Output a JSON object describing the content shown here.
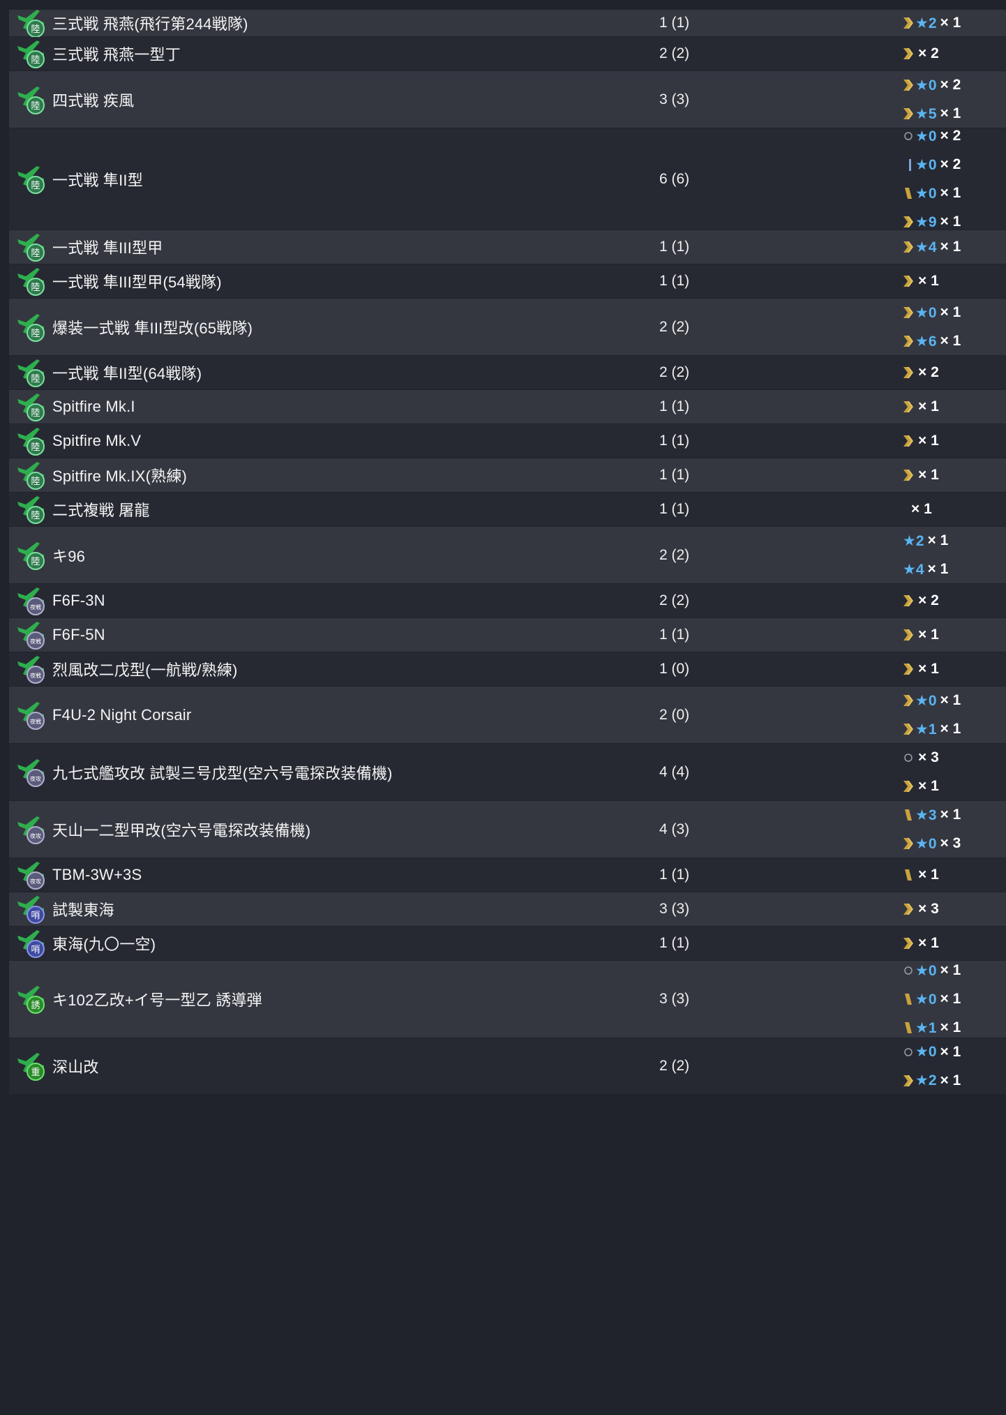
{
  "colors": {
    "background": "#20232b",
    "row_light": "#343740",
    "row_dark": "#262932",
    "star_blue": "#5ab4f2",
    "proficiency_gold": "#c9a23e",
    "proficiency_blue": "#7fa6d8",
    "proficiency_circle": "#9aa0a8"
  },
  "rows": [
    {
      "icon": "army-fighter-icon",
      "name": "三式戦 飛燕(飛行第244戦隊)",
      "count": "1 (1)",
      "levels": [
        {
          "badge": "chevron-double-gold-icon",
          "star": "★2",
          "mult": "× 1"
        }
      ]
    },
    {
      "icon": "army-fighter-icon",
      "name": "三式戦 飛燕一型丁",
      "count": "2 (2)",
      "levels": [
        {
          "badge": "chevron-double-gold-icon",
          "star": "",
          "mult": "× 2"
        }
      ]
    },
    {
      "icon": "army-fighter-icon",
      "name": "四式戦 疾風",
      "count": "3 (3)",
      "levels": [
        {
          "badge": "chevron-double-gold-icon",
          "star": "★0",
          "mult": "× 2"
        },
        {
          "badge": "chevron-double-gold-icon",
          "star": "★5",
          "mult": "× 1"
        }
      ]
    },
    {
      "icon": "army-fighter-icon",
      "name": "一式戦 隼II型",
      "count": "6 (6)",
      "levels": [
        {
          "badge": "circle-icon",
          "star": "★0",
          "mult": "× 2"
        },
        {
          "badge": "bar-blue-icon",
          "star": "★0",
          "mult": "× 2"
        },
        {
          "badge": "bars-gold-icon",
          "star": "★0",
          "mult": "× 1"
        },
        {
          "badge": "chevron-double-gold-icon",
          "star": "★9",
          "mult": "× 1"
        }
      ]
    },
    {
      "icon": "army-fighter-icon",
      "name": "一式戦 隼III型甲",
      "count": "1 (1)",
      "levels": [
        {
          "badge": "chevron-double-gold-icon",
          "star": "★4",
          "mult": "× 1"
        }
      ]
    },
    {
      "icon": "army-fighter-icon",
      "name": "一式戦 隼III型甲(54戦隊)",
      "count": "1 (1)",
      "levels": [
        {
          "badge": "chevron-double-gold-icon",
          "star": "",
          "mult": "× 1"
        }
      ]
    },
    {
      "icon": "army-fighter-icon",
      "name": "爆装一式戦 隼III型改(65戦隊)",
      "count": "2 (2)",
      "levels": [
        {
          "badge": "chevron-double-gold-icon",
          "star": "★0",
          "mult": "× 1"
        },
        {
          "badge": "chevron-double-gold-icon",
          "star": "★6",
          "mult": "× 1"
        }
      ]
    },
    {
      "icon": "army-fighter-icon",
      "name": "一式戦 隼II型(64戦隊)",
      "count": "2 (2)",
      "levels": [
        {
          "badge": "chevron-double-gold-icon",
          "star": "",
          "mult": "× 2"
        }
      ]
    },
    {
      "icon": "army-fighter-icon",
      "name": "Spitfire Mk.I",
      "count": "1 (1)",
      "levels": [
        {
          "badge": "chevron-double-gold-icon",
          "star": "",
          "mult": "× 1"
        }
      ]
    },
    {
      "icon": "army-fighter-icon",
      "name": "Spitfire Mk.V",
      "count": "1 (1)",
      "levels": [
        {
          "badge": "chevron-double-gold-icon",
          "star": "",
          "mult": "× 1"
        }
      ]
    },
    {
      "icon": "army-fighter-icon",
      "name": "Spitfire Mk.IX(熟練)",
      "count": "1 (1)",
      "levels": [
        {
          "badge": "chevron-double-gold-icon",
          "star": "",
          "mult": "× 1"
        }
      ]
    },
    {
      "icon": "army-fighter-icon",
      "name": "二式複戦 屠龍",
      "count": "1 (1)",
      "levels": [
        {
          "badge": "",
          "star": "",
          "mult": "× 1"
        }
      ]
    },
    {
      "icon": "army-fighter-icon",
      "name": "キ96",
      "count": "2 (2)",
      "levels": [
        {
          "badge": "",
          "star": "★2",
          "mult": "× 1"
        },
        {
          "badge": "",
          "star": "★4",
          "mult": "× 1"
        }
      ]
    },
    {
      "icon": "night-fighter-icon",
      "name": "F6F-3N",
      "count": "2 (2)",
      "levels": [
        {
          "badge": "chevron-double-gold-icon",
          "star": "",
          "mult": "× 2"
        }
      ]
    },
    {
      "icon": "night-fighter-icon",
      "name": "F6F-5N",
      "count": "1 (1)",
      "levels": [
        {
          "badge": "chevron-double-gold-icon",
          "star": "",
          "mult": "× 1"
        }
      ]
    },
    {
      "icon": "night-fighter-icon",
      "name": "烈風改二戊型(一航戦/熟練)",
      "count": "1 (0)",
      "levels": [
        {
          "badge": "chevron-double-gold-icon",
          "star": "",
          "mult": "× 1"
        }
      ]
    },
    {
      "icon": "night-fighter-icon",
      "name": "F4U-2 Night Corsair",
      "count": "2 (0)",
      "levels": [
        {
          "badge": "chevron-double-gold-icon",
          "star": "★0",
          "mult": "× 1"
        },
        {
          "badge": "chevron-double-gold-icon",
          "star": "★1",
          "mult": "× 1"
        }
      ]
    },
    {
      "icon": "night-attacker-icon",
      "name": "九七式艦攻改 試製三号戊型(空六号電探改装備機)",
      "count": "4 (4)",
      "levels": [
        {
          "badge": "circle-icon",
          "star": "",
          "mult": "× 3"
        },
        {
          "badge": "chevron-double-gold-icon",
          "star": "",
          "mult": "× 1"
        }
      ]
    },
    {
      "icon": "night-attacker-icon",
      "name": "天山一二型甲改(空六号電探改装備機)",
      "count": "4 (3)",
      "levels": [
        {
          "badge": "bars-gold-icon",
          "star": "★3",
          "mult": "× 1"
        },
        {
          "badge": "chevron-double-gold-icon",
          "star": "★0",
          "mult": "× 3"
        }
      ]
    },
    {
      "icon": "night-attacker-icon",
      "name": "TBM-3W+3S",
      "count": "1 (1)",
      "levels": [
        {
          "badge": "bars-gold-icon",
          "star": "",
          "mult": "× 1"
        }
      ]
    },
    {
      "icon": "illumination-plane-icon",
      "name": "試製東海",
      "count": "3 (3)",
      "levels": [
        {
          "badge": "chevron-double-gold-icon",
          "star": "",
          "mult": "× 3"
        }
      ]
    },
    {
      "icon": "illumination-plane-icon",
      "name": "東海(九〇一空)",
      "count": "1 (1)",
      "levels": [
        {
          "badge": "chevron-double-gold-icon",
          "star": "",
          "mult": "× 1"
        }
      ]
    },
    {
      "icon": "missile-plane-icon",
      "name": "キ102乙改+イ号一型乙 誘導弾",
      "count": "3 (3)",
      "levels": [
        {
          "badge": "circle-icon",
          "star": "★0",
          "mult": "× 1"
        },
        {
          "badge": "bars-gold-icon",
          "star": "★0",
          "mult": "× 1"
        },
        {
          "badge": "bars-gold-icon",
          "star": "★1",
          "mult": "× 1"
        }
      ]
    },
    {
      "icon": "heavy-bomber-icon",
      "name": "深山改",
      "count": "2 (2)",
      "levels": [
        {
          "badge": "circle-icon",
          "star": "★0",
          "mult": "× 1"
        },
        {
          "badge": "chevron-double-gold-icon",
          "star": "★2",
          "mult": "× 1"
        }
      ]
    }
  ]
}
